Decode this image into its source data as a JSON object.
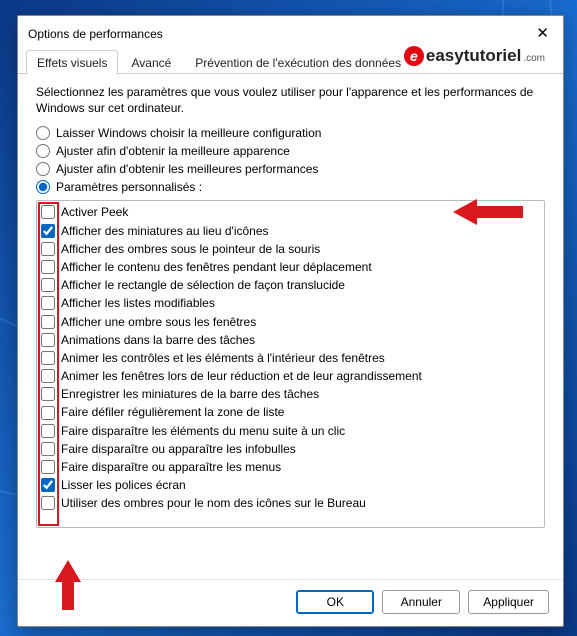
{
  "dialog": {
    "title": "Options de performances"
  },
  "watermark": {
    "brand": "easytutoriel",
    "suffix": ".com"
  },
  "tabs": [
    {
      "label": "Effets visuels",
      "active": true
    },
    {
      "label": "Avancé",
      "active": false
    },
    {
      "label": "Prévention de l'exécution des données",
      "active": false
    }
  ],
  "intro": "Sélectionnez les paramètres que vous voulez utiliser pour l'apparence et les performances de Windows sur cet ordinateur.",
  "radios": [
    {
      "label": "Laisser Windows choisir la meilleure configuration",
      "checked": false
    },
    {
      "label": "Ajuster afin d'obtenir la meilleure apparence",
      "checked": false
    },
    {
      "label": "Ajuster afin d'obtenir les meilleures performances",
      "checked": false
    },
    {
      "label": "Paramètres personnalisés :",
      "checked": true
    }
  ],
  "options": [
    {
      "label": "Activer Peek",
      "checked": false
    },
    {
      "label": "Afficher des miniatures au lieu d'icônes",
      "checked": true
    },
    {
      "label": "Afficher des ombres sous le pointeur de la souris",
      "checked": false
    },
    {
      "label": "Afficher le contenu des fenêtres pendant leur déplacement",
      "checked": false
    },
    {
      "label": "Afficher le rectangle de sélection de façon translucide",
      "checked": false
    },
    {
      "label": "Afficher les listes modifiables",
      "checked": false
    },
    {
      "label": "Afficher une ombre sous les fenêtres",
      "checked": false
    },
    {
      "label": "Animations dans la barre des tâches",
      "checked": false
    },
    {
      "label": "Animer les contrôles et les éléments à l'intérieur des fenêtres",
      "checked": false
    },
    {
      "label": "Animer les fenêtres lors de leur réduction et de leur agrandissement",
      "checked": false
    },
    {
      "label": "Enregistrer les miniatures de la barre des tâches",
      "checked": false
    },
    {
      "label": "Faire défiler régulièrement la zone de liste",
      "checked": false
    },
    {
      "label": "Faire disparaître les éléments du menu suite à un clic",
      "checked": false
    },
    {
      "label": "Faire disparaître ou apparaître les infobulles",
      "checked": false
    },
    {
      "label": "Faire disparaître ou apparaître les menus",
      "checked": false
    },
    {
      "label": "Lisser les polices écran",
      "checked": true
    },
    {
      "label": "Utiliser des ombres pour le nom des icônes sur le Bureau",
      "checked": false
    }
  ],
  "buttons": {
    "ok": "OK",
    "cancel": "Annuler",
    "apply": "Appliquer"
  },
  "annotations": {
    "arrow_color": "#d9171e"
  }
}
